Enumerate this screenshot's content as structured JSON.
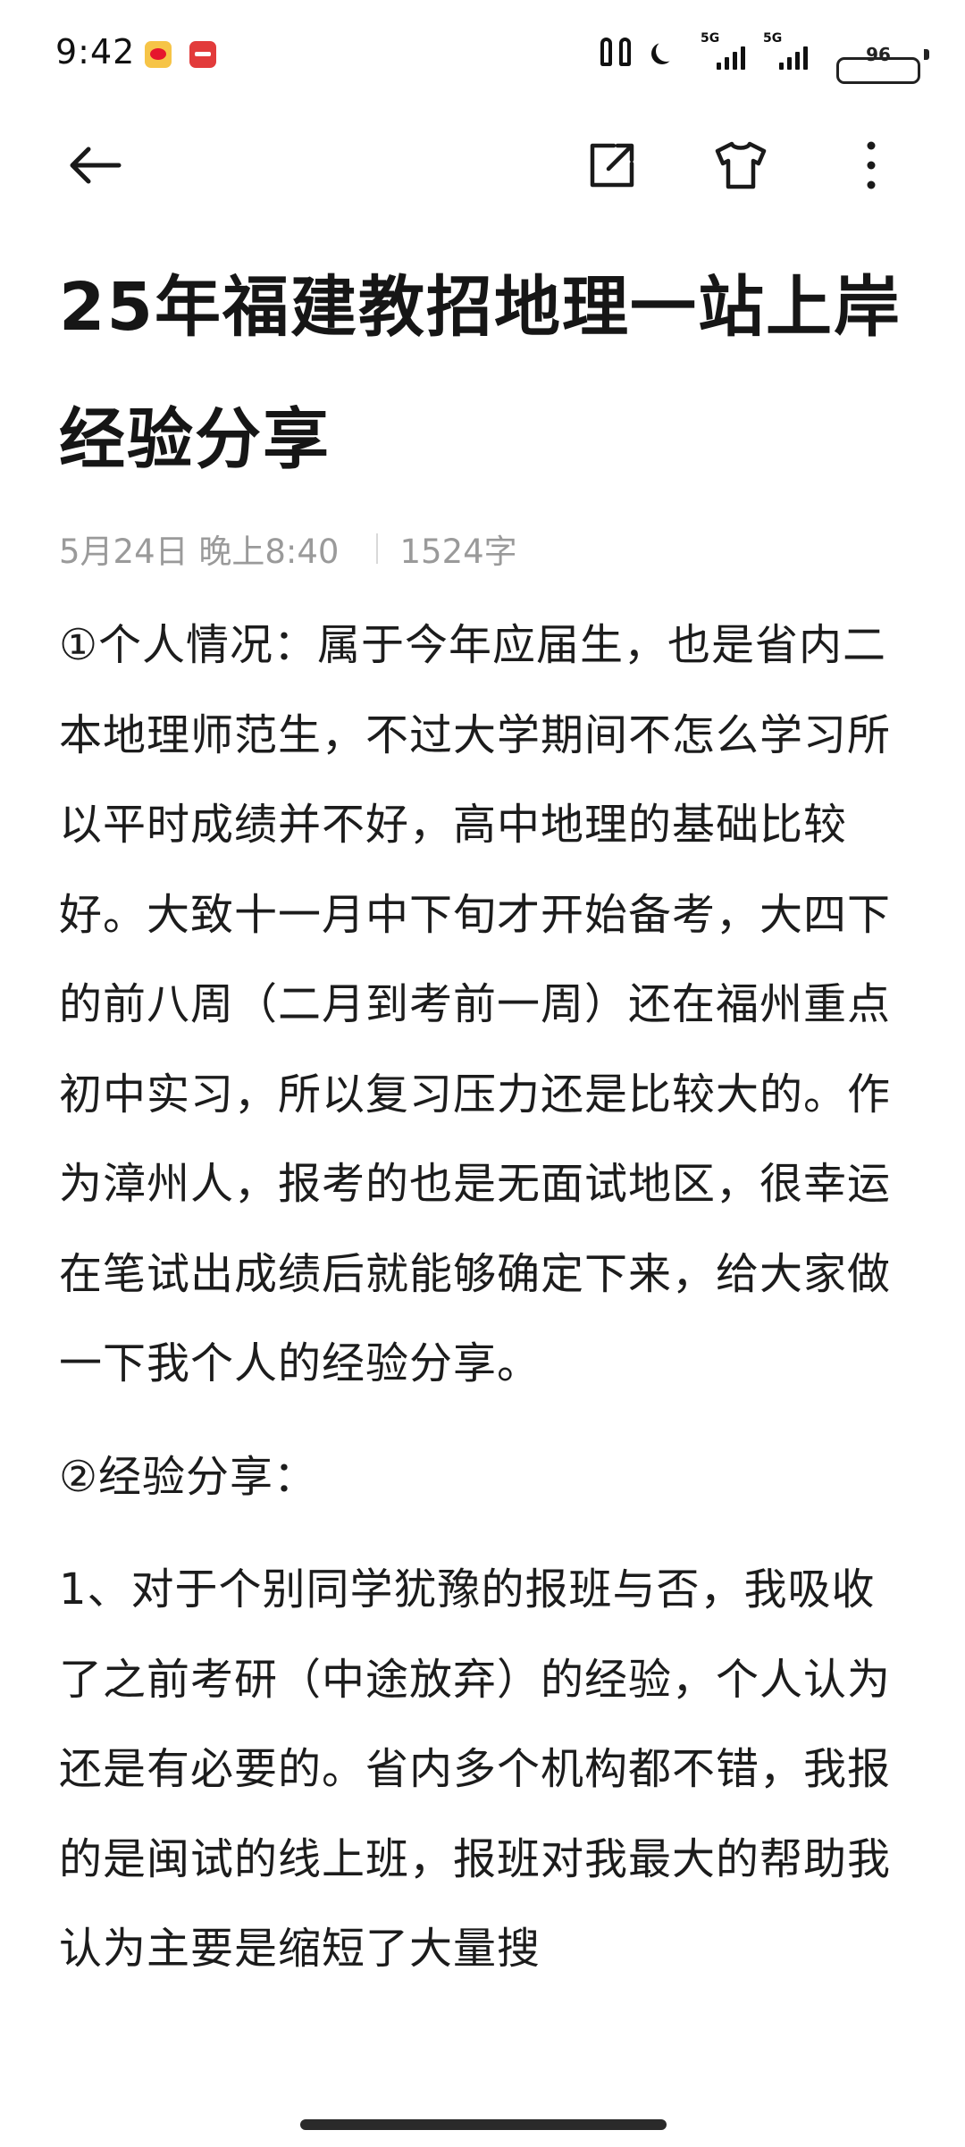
{
  "status_bar": {
    "time": "9:42",
    "notification_icons": [
      "weibo-icon",
      "red-app-icon"
    ],
    "network_1": "5G",
    "network_2": "5G",
    "battery": "96"
  },
  "nav": {
    "back_icon": "arrow-left-icon",
    "share_icon": "share-external-icon",
    "theme_icon": "tshirt-icon",
    "more_icon": "more-vertical-icon"
  },
  "article": {
    "title": "25年福建教招地理一站上岸经验分享",
    "date": "5月24日 晚上8:40",
    "word_count": "1524字",
    "paragraphs": [
      "①个人情况：属于今年应届生，也是省内二本地理师范生，不过大学期间不怎么学习所以平时成绩并不好，高中地理的基础比较好。大致十一月中下旬才开始备考，大四下的前八周（二月到考前一周）还在福州重点初中实习，所以复习压力还是比较大的。作为漳州人，报考的也是无面试地区，很幸运在笔试出成绩后就能够确定下来，给大家做一下我个人的经验分享。",
      "②经验分享：",
      "1、对于个别同学犹豫的报班与否，我吸收了之前考研（中途放弃）的经验，个人认为还是有必要的。省内多个机构都不错，我报的是闽试的线上班，报班对我最大的帮助我认为主要是缩短了大量搜"
    ]
  },
  "colors": {
    "text": "#1c1c1c",
    "meta": "#9a9a9a",
    "background": "#ffffff"
  }
}
